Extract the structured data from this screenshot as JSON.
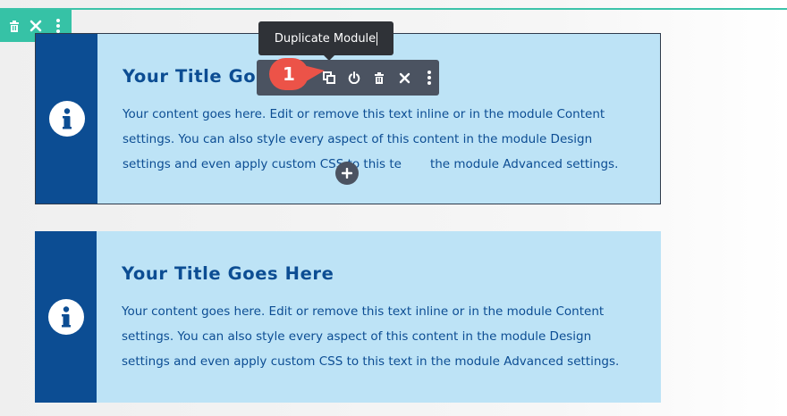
{
  "tooltip": {
    "label": "Duplicate Module"
  },
  "step_marker": {
    "number": "1"
  },
  "blurbs": [
    {
      "title": "Your Title Goe",
      "text": "Your content goes here. Edit or remove this text inline or in the module Content settings. You can also style every aspect of this content in the module Design settings and even apply custom CSS to this te"
    },
    {
      "title": "Your Title Goes Here",
      "text": "Your content goes here. Edit or remove this text inline or in the module Content settings. You can also style every aspect of this content in the module Design settings and even apply custom CSS to this text in the module Advanced settings."
    }
  ],
  "blurb1_tail_text": "the module Advanced settings.",
  "colors": {
    "accent": "#36c2a6",
    "toolbar_bg": "#4b5361",
    "badge": "#ec5348",
    "blurb_bg": "#bde3f6",
    "blurb_side": "#0c4d93"
  },
  "icons": {
    "row_toolbar": [
      "trash-icon",
      "close-icon",
      "more-vertical-icon"
    ],
    "module_toolbar": [
      "duplicate-icon",
      "power-icon",
      "trash-icon",
      "close-icon",
      "more-vertical-icon"
    ],
    "blurb": "info-icon",
    "add": "plus-icon"
  }
}
